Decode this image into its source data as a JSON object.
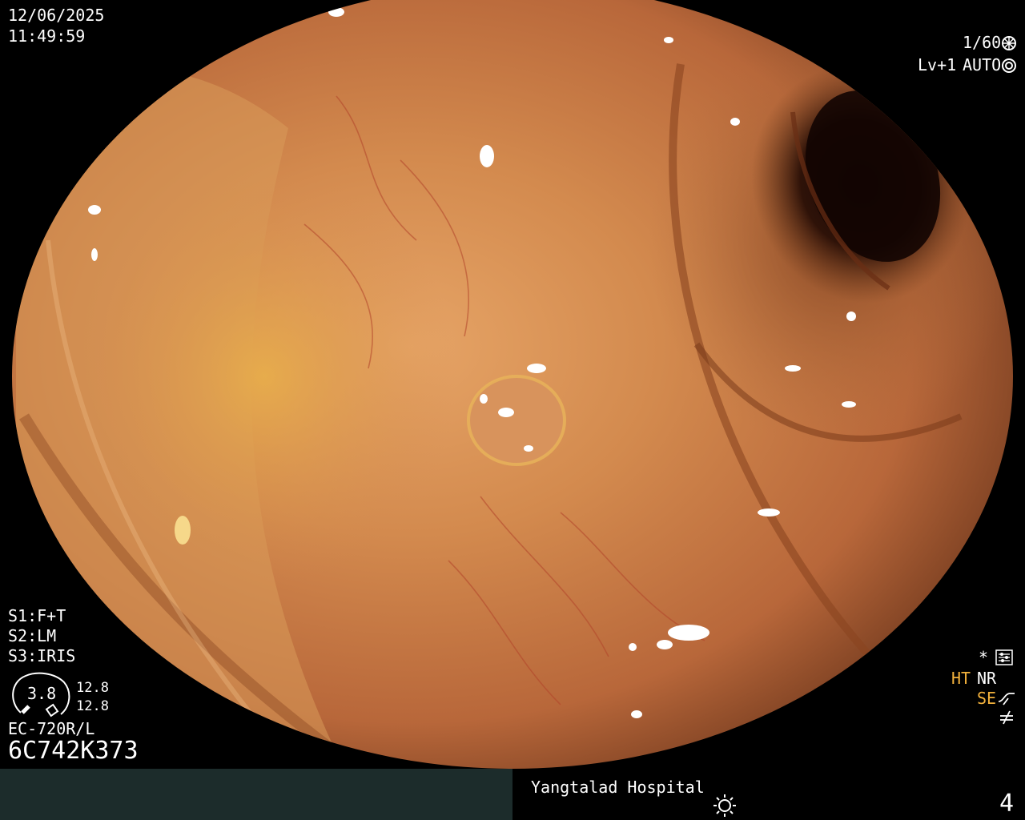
{
  "overlay": {
    "date": "12/06/2025",
    "time": "11:49:59",
    "shutter": "1/60",
    "shutter_icon": "aperture-icon",
    "level": "Lv+1",
    "exposure_mode": "AUTO",
    "exposure_icon": "iris-icon",
    "s1": "S1:F+T",
    "s2": "S2:LM",
    "s3": "S3:IRIS",
    "gauge_value": "3.8",
    "gauge_upper": "12.8",
    "gauge_lower": "12.8",
    "scope_model": "EC-720R/L",
    "serial": "6C742K373",
    "asterisk": "*",
    "ht_label": "HT",
    "nr_label": "NR",
    "se_label": "SE",
    "settings_icon": "settings-panel-icon",
    "curve_icon": "curve-icon",
    "not_equal_icon": "not-equal-icon"
  },
  "footer": {
    "hospital": "Yangtalad Hospital",
    "light_icon": "light-sun-icon",
    "page_number": "4"
  },
  "colors": {
    "footer_left": "#1c2c2b",
    "overlay_orange": "#f2b13c",
    "mucosa": "#c87a3e"
  }
}
